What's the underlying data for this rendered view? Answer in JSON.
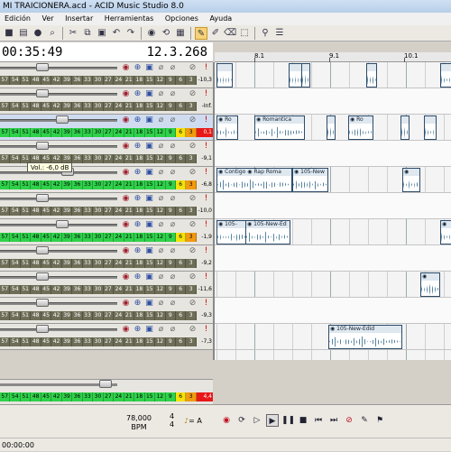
{
  "window": {
    "title": "MI TRAICIONERA.acd - ACID Music Studio 8.0"
  },
  "menu": [
    "Edición",
    "Ver",
    "Insertar",
    "Herramientas",
    "Opciones",
    "Ayuda"
  ],
  "toolbar": {
    "icons": [
      "save-icon",
      "open-icon",
      "user-icon",
      "search-icon",
      "cut-icon",
      "copy-icon",
      "paste-icon",
      "undo-icon",
      "redo-icon",
      "record-icon",
      "loop-icon",
      "grid-icon",
      "draw-icon",
      "paint-icon",
      "erase-icon",
      "select-icon",
      "snap-icon",
      "properties-icon"
    ]
  },
  "time": {
    "position": "00:35:49",
    "measure": "12.3.268"
  },
  "ruler": {
    "labels": [
      "8.1",
      "9.1",
      "10.1"
    ]
  },
  "meter_scale": [
    "57",
    "54",
    "51",
    "48",
    "45",
    "42",
    "39",
    "36",
    "33",
    "30",
    "27",
    "24",
    "21",
    "18",
    "15",
    "12",
    "9",
    "6",
    "3"
  ],
  "tracks": [
    {
      "peak": "-10,3",
      "active": false,
      "peak_red": false
    },
    {
      "peak": "-Inf.",
      "active": false,
      "peak_red": false
    },
    {
      "peak": "0,1",
      "active": true,
      "peak_red": true
    },
    {
      "peak": "-9,1",
      "active": false,
      "peak_red": false
    },
    {
      "peak": "-6,8",
      "active": true,
      "peak_red": false
    },
    {
      "peak": "-10,0",
      "active": false,
      "peak_red": false
    },
    {
      "peak": "-1,9",
      "active": true,
      "peak_red": false
    },
    {
      "peak": "-9,2",
      "active": false,
      "peak_red": false
    },
    {
      "peak": "-11,6",
      "active": false,
      "peak_red": false
    },
    {
      "peak": "-9,3",
      "active": false,
      "peak_red": false
    },
    {
      "peak": "-7,3",
      "active": false,
      "peak_red": false
    }
  ],
  "tooltip": {
    "text": "Vol.: -6,0 dB"
  },
  "clips": {
    "c1": "Ro",
    "c2": "Romantica",
    "c3": "Ro",
    "c4": "Contigo",
    "c5": "Rap Roma",
    "c6": "105-New",
    "c7": "105-New-Ed",
    "c8": "105-",
    "c9": "105-New-Edid"
  },
  "master": {
    "peak": "4,4"
  },
  "bottom": {
    "tempo_value": "78,000",
    "tempo_label": "BPM",
    "sig_top": "4",
    "sig_bottom": "4",
    "key": "= A"
  },
  "status": {
    "time": "00:00:00"
  }
}
